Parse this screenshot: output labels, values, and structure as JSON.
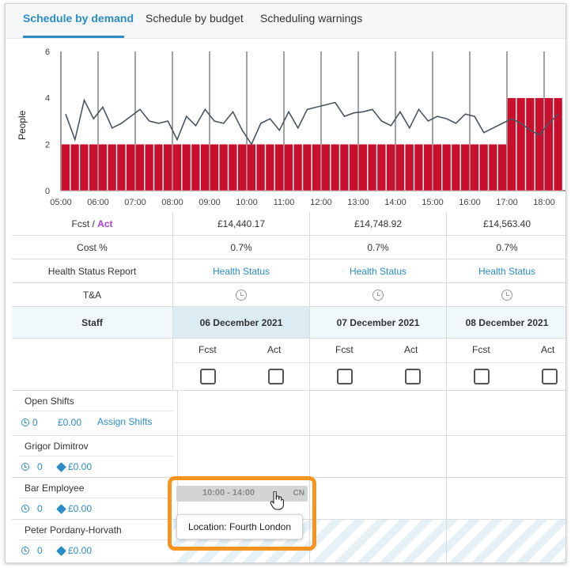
{
  "tabs": [
    {
      "label": "Schedule by demand",
      "active": true
    },
    {
      "label": "Schedule by budget",
      "active": false
    },
    {
      "label": "Scheduling warnings",
      "active": false
    }
  ],
  "chart_data": {
    "type": "bar+line",
    "ylabel": "People",
    "ylim": [
      0,
      6
    ],
    "yticks": [
      "0",
      "2",
      "4",
      "6"
    ],
    "xticks": [
      "05:00",
      "06:00",
      "07:00",
      "08:00",
      "09:00",
      "10:00",
      "11:00",
      "12:00",
      "13:00",
      "14:00",
      "15:00",
      "16:00",
      "17:00",
      "18:00"
    ],
    "bar_color": "#c8102e",
    "line_color": "#4a5560",
    "bars_start": "05:00",
    "bars_step_minutes": 15,
    "bar_values": [
      2,
      2,
      2,
      2,
      2,
      2,
      2,
      2,
      2,
      2,
      2,
      2,
      2,
      2,
      2,
      2,
      2,
      2,
      2,
      2,
      2,
      2,
      2,
      2,
      2,
      2,
      2,
      2,
      2,
      2,
      2,
      2,
      2,
      2,
      2,
      2,
      2,
      2,
      2,
      2,
      2,
      2,
      2,
      2,
      2,
      2,
      2,
      2,
      4,
      4,
      4,
      4,
      4,
      4,
      4
    ],
    "line_values": [
      3.3,
      2.2,
      3.9,
      3.1,
      3.6,
      2.7,
      2.9,
      3.2,
      3.5,
      3.0,
      2.9,
      3.0,
      2.2,
      3.2,
      2.8,
      3.5,
      3.0,
      2.9,
      3.4,
      2.6,
      2.0,
      2.9,
      3.1,
      2.6,
      3.4,
      2.7,
      3.5,
      3.6,
      3.7,
      3.8,
      3.2,
      3.35,
      3.4,
      3.5,
      3.0,
      2.8,
      3.4,
      2.7,
      3.5,
      3.0,
      3.2,
      3.1,
      2.9,
      3.3,
      3.2,
      2.5,
      2.7,
      2.9,
      3.1,
      2.9,
      2.6,
      2.4,
      2.9,
      3.3,
      2.8
    ]
  },
  "table": {
    "columns": [
      "06 December 2021",
      "07 December 2021",
      "08 December 2021"
    ],
    "fcst_label": "Fcst",
    "act_label": "Act",
    "fcst_act_slash": " / ",
    "fcst_act_values": [
      "£14,440.17",
      "£14,748.92",
      "£14,563.40"
    ],
    "cost_label": "Cost %",
    "cost_values": [
      "0.7%",
      "0.7%",
      "0.7%"
    ],
    "health_label": "Health Status Report",
    "health_link": "Health Status",
    "ta_label": "T&A",
    "staff_header": "Staff",
    "sub_fcst": "Fcst",
    "sub_act": "Act"
  },
  "staff": [
    {
      "name": "Open Shifts",
      "hours": "0",
      "cost": "£0.00",
      "action": "Assign Shifts"
    },
    {
      "name": "Grigor Dimitrov",
      "hours": "0",
      "cost": "£0.00"
    },
    {
      "name": "Bar Employee",
      "hours": "0",
      "cost": "£0.00"
    },
    {
      "name": "Peter Pordany-Horvath",
      "hours": "0",
      "cost": "£0.00"
    }
  ],
  "shift": {
    "time": "10:00 - 14:00",
    "code": "CN",
    "tooltip": "Location: Fourth London"
  },
  "colors": {
    "accent": "#2a8dc8",
    "highlight": "#f7941d",
    "bar": "#c8102e",
    "act": "#b03ad6"
  }
}
